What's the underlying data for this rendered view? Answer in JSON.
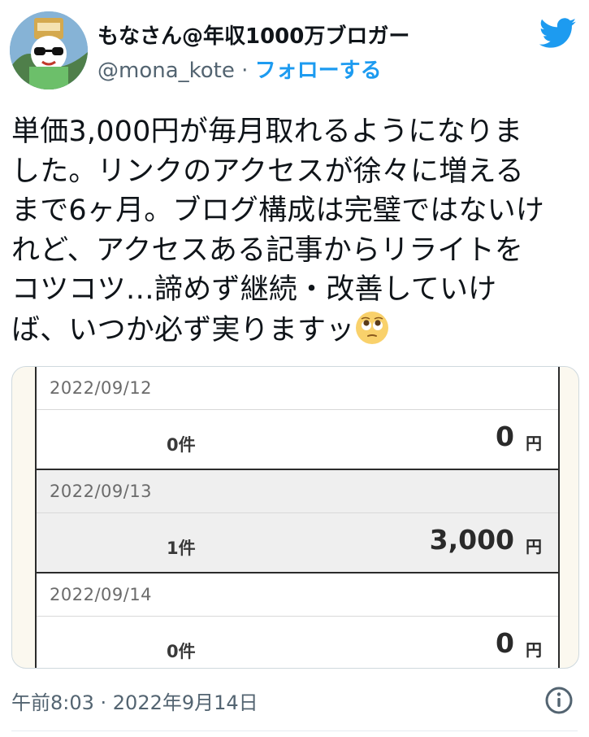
{
  "author": {
    "display_name": "もなさん@年収1000万ブロガー",
    "handle": "@mona_kote",
    "separator": "·",
    "follow_label": "フォローする"
  },
  "tweet": {
    "text": "単価3,000円が毎月取れるようになりま\nした。リンクのアクセスが徐々に増える\nまで6ヶ月。ブログ構成は完璧ではないけ\nれど、アクセスある記事からリライトを\nコツコツ…諦めず継続・改善していけ\nば、いつか必ず実りますッ",
    "trailing_emoji": "pleading-face-emoji"
  },
  "media": {
    "entries": [
      {
        "date": "2022/09/12",
        "count": "0件",
        "amount": "0",
        "unit": "円"
      },
      {
        "date": "2022/09/13",
        "count": "1件",
        "amount": "3,000",
        "unit": "円"
      },
      {
        "date": "2022/09/14",
        "count": "0件",
        "amount": "0",
        "unit": "円"
      }
    ]
  },
  "meta": {
    "timestamp": "午前8:03 · 2022年9月14日"
  },
  "colors": {
    "accent": "#1d9bf0",
    "muted_text": "#536471",
    "highlight_row": "#efefef"
  },
  "icons": {
    "brand": "twitter-bird-icon",
    "info": "info-circle-icon"
  }
}
